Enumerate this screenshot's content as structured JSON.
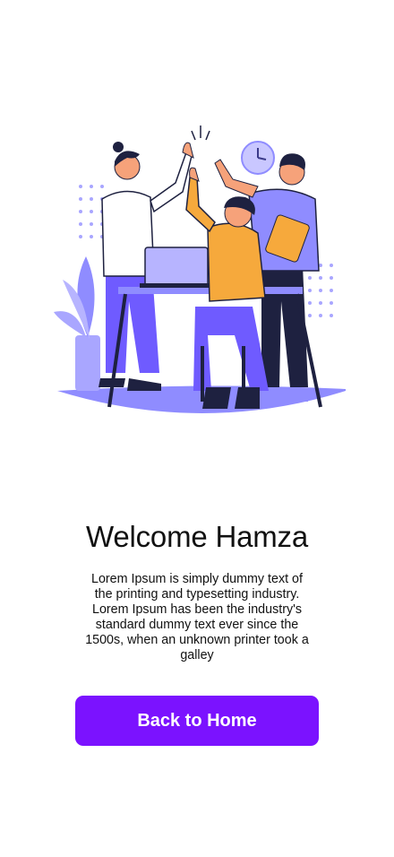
{
  "welcome": {
    "title": "Welcome Hamza",
    "description": "Lorem Ipsum is simply dummy text of the printing and typesetting industry. Lorem Ipsum has been the industry's standard dummy text ever since the 1500s, when an unknown printer took a galley"
  },
  "actions": {
    "back_label": "Back to Home"
  },
  "colors": {
    "accent": "#7b12ff",
    "illustration_purple": "#8f8cff",
    "illustration_orange": "#f6a93c",
    "illustration_navy": "#1e2140"
  },
  "illustration": {
    "icon": "team-high-five-illustration"
  }
}
